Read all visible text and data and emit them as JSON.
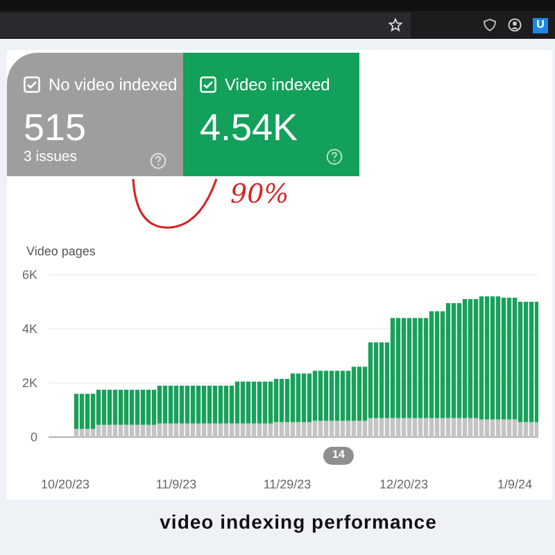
{
  "browser": {
    "extension_badge": "U"
  },
  "cards": [
    {
      "kind": "gray",
      "label": "No video indexed",
      "checked": true,
      "value": "515",
      "sub": "3 issues"
    },
    {
      "kind": "green",
      "label": "Video indexed",
      "checked": true,
      "value": "4.54K"
    }
  ],
  "annotation": {
    "text": "90%"
  },
  "chart": {
    "badge": "14",
    "chart_data": {
      "type": "bar",
      "stacked": true,
      "ylabel": "Video pages",
      "categories": [
        "10/20/23",
        null,
        null,
        null,
        null,
        null,
        null,
        null,
        null,
        null,
        null,
        null,
        null,
        null,
        null,
        null,
        null,
        null,
        null,
        null,
        "11/9/23",
        null,
        null,
        null,
        null,
        null,
        null,
        null,
        null,
        null,
        null,
        null,
        null,
        null,
        null,
        null,
        null,
        null,
        null,
        null,
        "11/29/23",
        null,
        null,
        null,
        null,
        null,
        null,
        null,
        null,
        null,
        null,
        null,
        null,
        null,
        null,
        null,
        null,
        null,
        null,
        null,
        null,
        "12/20/23",
        null,
        null,
        null,
        null,
        null,
        null,
        null,
        null,
        null,
        null,
        null,
        null,
        null,
        null,
        null,
        null,
        null,
        null,
        null,
        "1/9/24",
        null,
        null,
        null,
        null
      ],
      "ylim": [
        0,
        6000
      ],
      "series": [
        {
          "color": "#c4c4c4",
          "values": [
            null,
            null,
            300,
            300,
            300,
            300,
            450,
            450,
            450,
            450,
            450,
            450,
            450,
            450,
            450,
            450,
            450,
            500,
            500,
            500,
            500,
            500,
            500,
            500,
            500,
            500,
            500,
            500,
            500,
            500,
            500,
            500,
            500,
            500,
            500,
            500,
            500,
            500,
            550,
            550,
            550,
            550,
            550,
            550,
            550,
            600,
            600,
            600,
            600,
            600,
            600,
            600,
            600,
            600,
            600,
            700,
            700,
            700,
            700,
            700,
            700,
            700,
            700,
            700,
            700,
            700,
            700,
            700,
            700,
            700,
            700,
            700,
            700,
            700,
            700,
            650,
            650,
            650,
            650,
            650,
            650,
            650,
            550,
            550,
            550,
            550
          ]
        },
        {
          "color": "#18a05b",
          "values": [
            null,
            null,
            1300,
            1300,
            1300,
            1300,
            1300,
            1300,
            1300,
            1300,
            1300,
            1300,
            1300,
            1300,
            1300,
            1300,
            1300,
            1400,
            1400,
            1400,
            1400,
            1400,
            1400,
            1400,
            1400,
            1400,
            1400,
            1400,
            1400,
            1400,
            1400,
            1550,
            1550,
            1550,
            1550,
            1550,
            1550,
            1550,
            1600,
            1600,
            1600,
            1800,
            1800,
            1800,
            1800,
            1850,
            1850,
            1850,
            1850,
            1850,
            1850,
            1850,
            2000,
            2000,
            2000,
            2800,
            2800,
            2800,
            2800,
            3700,
            3700,
            3700,
            3700,
            3700,
            3700,
            3700,
            3950,
            3950,
            3950,
            4250,
            4250,
            4250,
            4400,
            4400,
            4400,
            4550,
            4550,
            4550,
            4550,
            4500,
            4500,
            4500,
            4450,
            4450,
            4450,
            4450
          ]
        }
      ],
      "yticks": [
        {
          "value": 0,
          "label": "0"
        },
        {
          "value": 2000,
          "label": "2K"
        },
        {
          "value": 4000,
          "label": "4K"
        },
        {
          "value": 6000,
          "label": "6K"
        }
      ]
    }
  },
  "caption": "video indexing performance"
}
